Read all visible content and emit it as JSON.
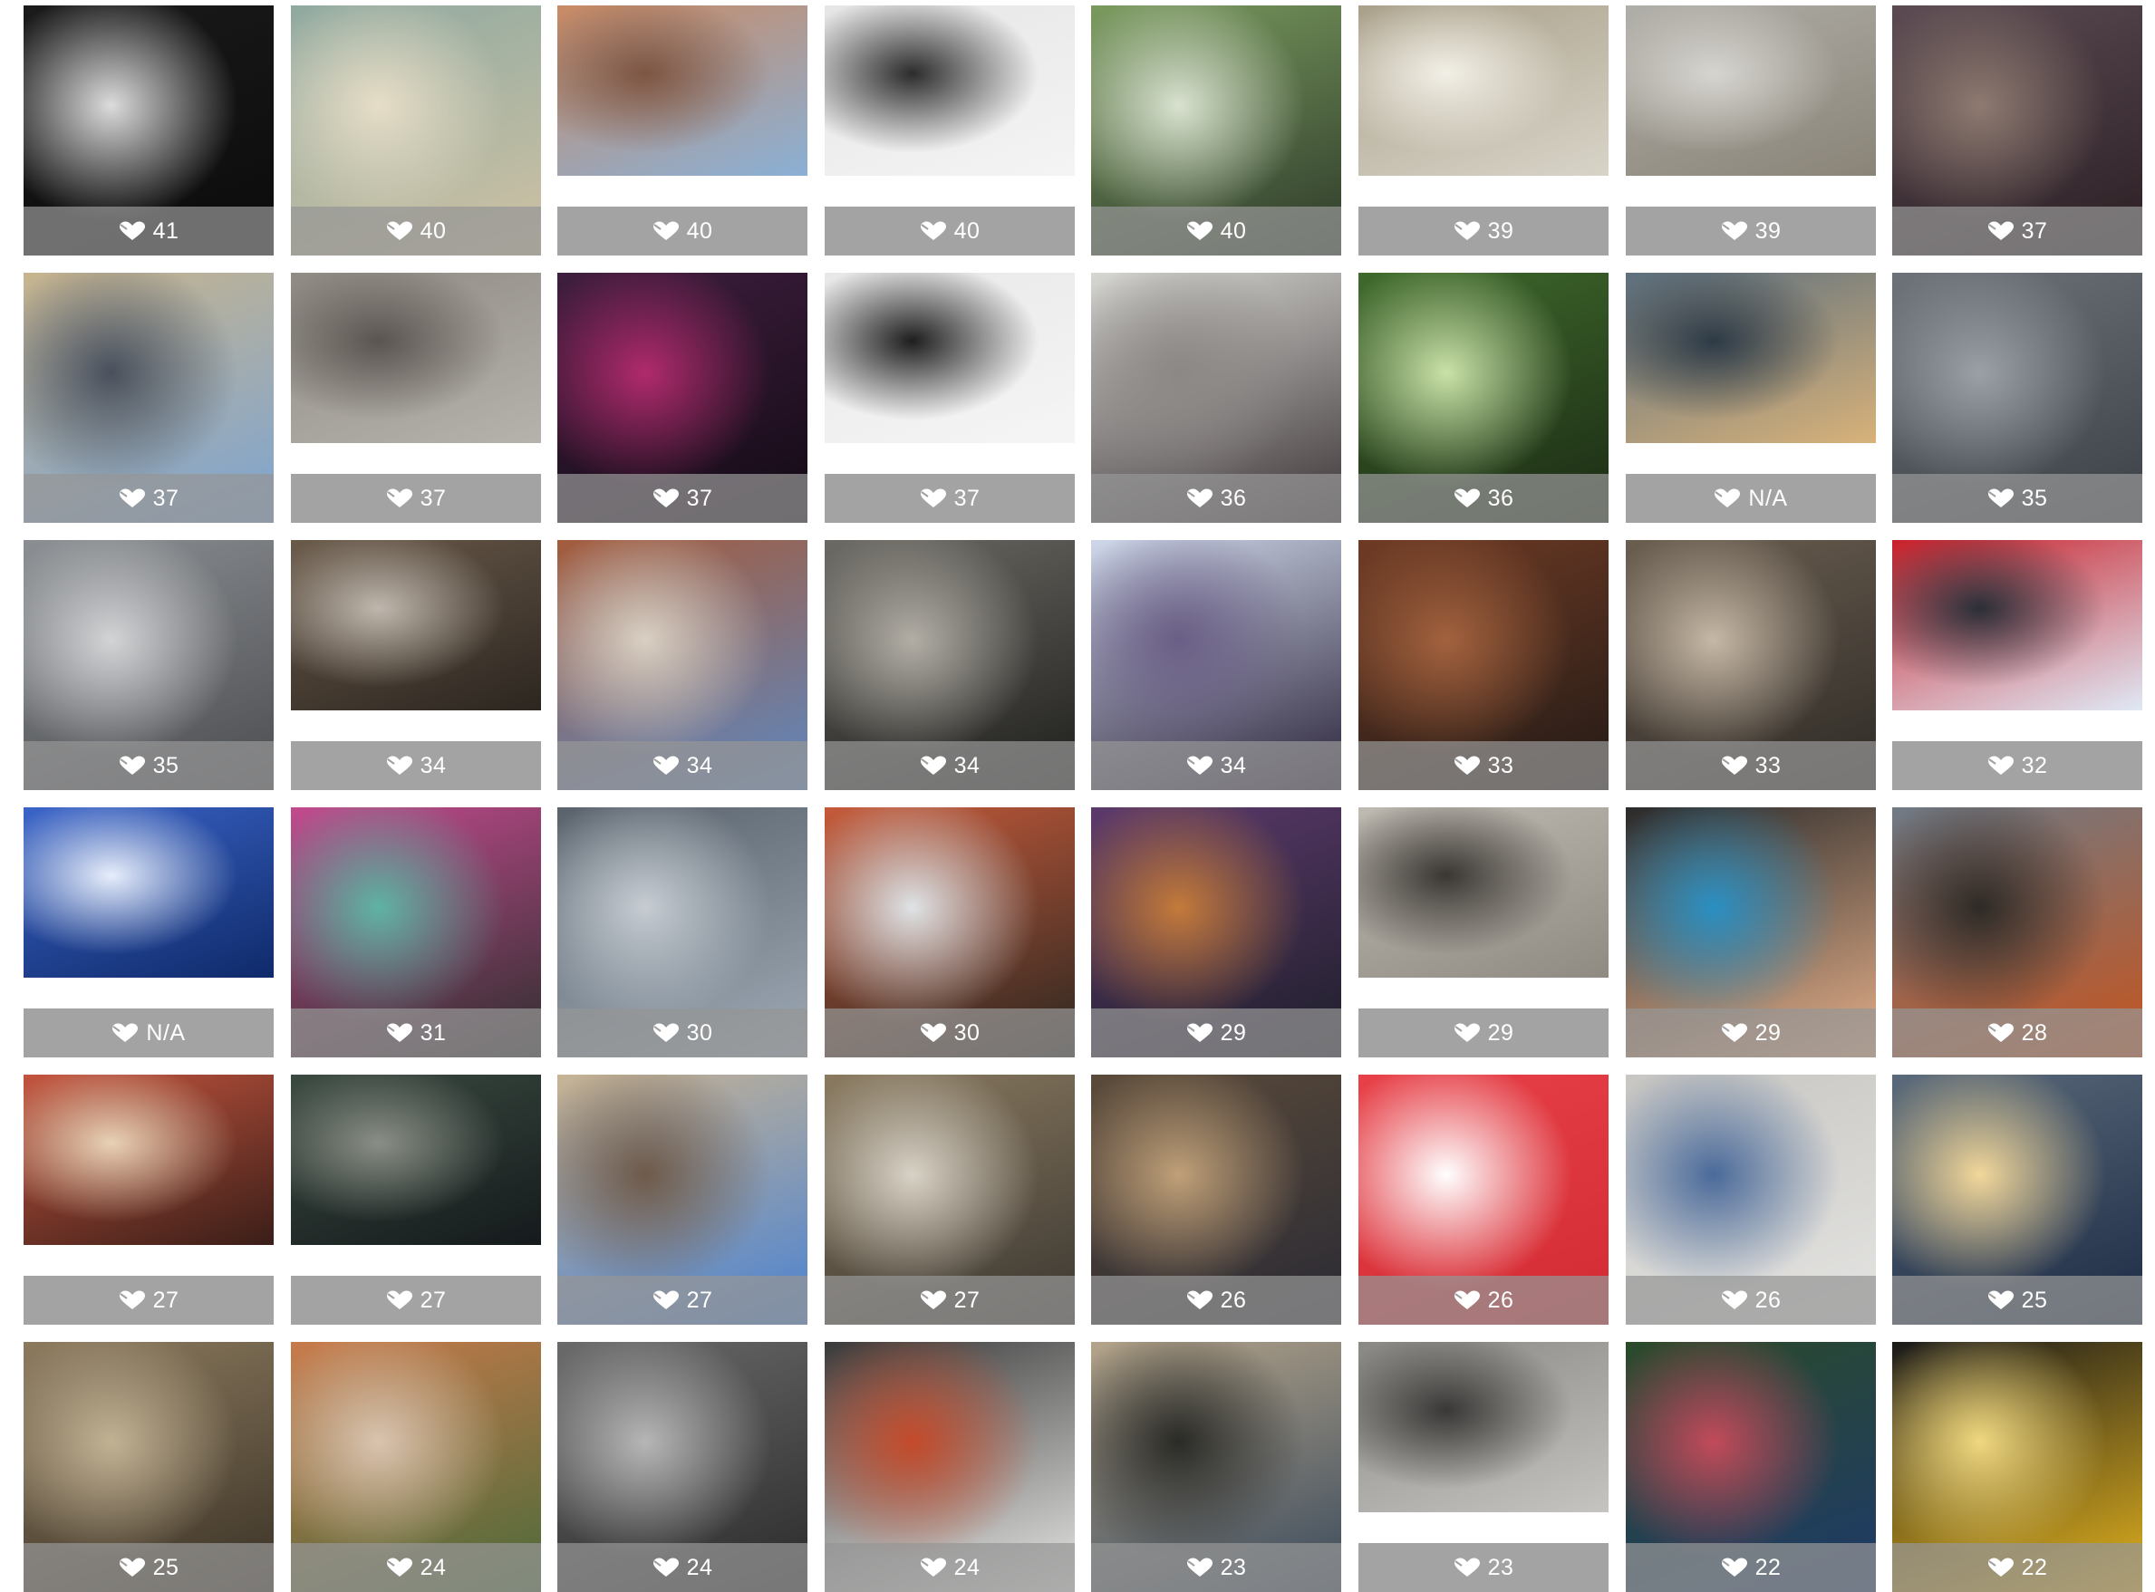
{
  "gallery": {
    "like_icon": "heart-icon",
    "tiles": [
      {
        "likes": "41",
        "colors": [
          "#0b0b0b",
          "#1a1a1a",
          "#dcdcdc"
        ],
        "full": true
      },
      {
        "likes": "40",
        "colors": [
          "#cfc2a4",
          "#8fa9a0",
          "#e6ddc7"
        ],
        "full": true
      },
      {
        "likes": "40",
        "colors": [
          "#8ab0d6",
          "#c98a64",
          "#7d5542"
        ],
        "full": false
      },
      {
        "likes": "40",
        "colors": [
          "#f4f4f4",
          "#e6e6e6",
          "#2c2c2c"
        ],
        "full": false
      },
      {
        "likes": "40",
        "colors": [
          "#2d3a2a",
          "#7a9a5e",
          "#d9e2d0"
        ],
        "full": true
      },
      {
        "likes": "39",
        "colors": [
          "#d8d4c8",
          "#a9a08a",
          "#f2efe6"
        ],
        "full": false
      },
      {
        "likes": "39",
        "colors": [
          "#8a8478",
          "#b0aea8",
          "#d7d5d0"
        ],
        "full": false
      },
      {
        "likes": "37",
        "colors": [
          "#2a1f24",
          "#5b4a52",
          "#8e7a70"
        ],
        "full": true
      },
      {
        "likes": "37",
        "colors": [
          "#7ca4d2",
          "#c7b48e",
          "#49505c"
        ],
        "full": true
      },
      {
        "likes": "37",
        "colors": [
          "#b6b2ac",
          "#8f8a84",
          "#5a5550"
        ],
        "full": false
      },
      {
        "likes": "37",
        "colors": [
          "#120a14",
          "#3e1e3e",
          "#b02a6c"
        ],
        "full": true
      },
      {
        "likes": "37",
        "colors": [
          "#f5f5f5",
          "#e8e8e8",
          "#1e1e1e"
        ],
        "full": false
      },
      {
        "likes": "36",
        "colors": [
          "#3c3436",
          "#d7d7d3",
          "#8c8886"
        ],
        "full": true
      },
      {
        "likes": "36",
        "colors": [
          "#1b2a14",
          "#3f6a2c",
          "#c9e2a8"
        ],
        "full": true
      },
      {
        "likes": "N/A",
        "colors": [
          "#d8b27a",
          "#5c6f7e",
          "#2d3a46"
        ],
        "full": false
      },
      {
        "likes": "35",
        "colors": [
          "#3b4046",
          "#6d7279",
          "#9aa0a6"
        ],
        "full": true
      },
      {
        "likes": "35",
        "colors": [
          "#4a4c50",
          "#8b8e92",
          "#d2d4d6"
        ],
        "full": true
      },
      {
        "likes": "34",
        "colors": [
          "#2c2620",
          "#6a5a4a",
          "#bfb7ad"
        ],
        "full": false
      },
      {
        "likes": "34",
        "colors": [
          "#5e88c0",
          "#a35b3c",
          "#d9d0c2"
        ],
        "full": true
      },
      {
        "likes": "34",
        "colors": [
          "#1d1d1b",
          "#6c6a64",
          "#b2aea6"
        ],
        "full": true
      },
      {
        "likes": "34",
        "colors": [
          "#2a2238",
          "#cfd8ea",
          "#6a5e86"
        ],
        "full": true
      },
      {
        "likes": "33",
        "colors": [
          "#221a16",
          "#6e3a24",
          "#a3623e"
        ],
        "full": true
      },
      {
        "likes": "33",
        "colors": [
          "#2e2a26",
          "#6a5e50",
          "#c6b8a6"
        ],
        "full": true
      },
      {
        "likes": "32",
        "colors": [
          "#dfe9f5",
          "#c8202a",
          "#2a2f38"
        ],
        "full": false
      },
      {
        "likes": "N/A",
        "colors": [
          "#0f2a6a",
          "#3a64c8",
          "#e7eefb"
        ],
        "full": false
      },
      {
        "likes": "31",
        "colors": [
          "#2e2e2e",
          "#c24a8e",
          "#5fb3a4"
        ],
        "full": true
      },
      {
        "likes": "30",
        "colors": [
          "#9eaab6",
          "#5a636c",
          "#c6ccd2"
        ],
        "full": true
      },
      {
        "likes": "30",
        "colors": [
          "#2a2620",
          "#c55a3a",
          "#dfe3e6"
        ],
        "full": true
      },
      {
        "likes": "29",
        "colors": [
          "#1e1e2a",
          "#5c3a6c",
          "#c47a3a"
        ],
        "full": true
      },
      {
        "likes": "29",
        "colors": [
          "#8f8a82",
          "#bfbab2",
          "#3a3632"
        ],
        "full": false
      },
      {
        "likes": "29",
        "colors": [
          "#e6b08a",
          "#2a2a2a",
          "#2a8fc2"
        ],
        "full": true
      },
      {
        "likes": "28",
        "colors": [
          "#c5541e",
          "#6f7a86",
          "#2e2a26"
        ],
        "full": true
      },
      {
        "likes": "27",
        "colors": [
          "#3a1e18",
          "#c4543e",
          "#e8d2b6"
        ],
        "full": false
      },
      {
        "likes": "27",
        "colors": [
          "#151a1c",
          "#3a4a40",
          "#8a8f86"
        ],
        "full": false
      },
      {
        "likes": "27",
        "colors": [
          "#4a82d2",
          "#c8b494",
          "#6e5a4a"
        ],
        "full": true
      },
      {
        "likes": "27",
        "colors": [
          "#3a3630",
          "#8a7a60",
          "#d8d2c6"
        ],
        "full": true
      },
      {
        "likes": "26",
        "colors": [
          "#2a2a34",
          "#5a4a3a",
          "#c0a078"
        ],
        "full": true
      },
      {
        "likes": "26",
        "colors": [
          "#d32b33",
          "#e84048",
          "#ffffff"
        ],
        "full": true
      },
      {
        "likes": "26",
        "colors": [
          "#e4e4e2",
          "#c8c6c2",
          "#4a6a9a"
        ],
        "full": true
      },
      {
        "likes": "25",
        "colors": [
          "#1c2a44",
          "#5a6a7a",
          "#f2d79a"
        ],
        "full": true
      },
      {
        "likes": "25",
        "colors": [
          "#3a3226",
          "#8c7a5e",
          "#c2b294"
        ],
        "full": true
      },
      {
        "likes": "24",
        "colors": [
          "#4a6a3a",
          "#c87a4a",
          "#d9c4b0"
        ],
        "full": true
      },
      {
        "likes": "24",
        "colors": [
          "#2a2a2a",
          "#6a6a6a",
          "#b6b6b6"
        ],
        "full": true
      },
      {
        "likes": "24",
        "colors": [
          "#e8e8e6",
          "#3a3a3a",
          "#c44a2a"
        ],
        "full": true
      },
      {
        "likes": "23",
        "colors": [
          "#3a4a5c",
          "#b4a48a",
          "#2a2a26"
        ],
        "full": true
      },
      {
        "likes": "23",
        "colors": [
          "#c6c4c0",
          "#8a8884",
          "#3a3836"
        ],
        "full": false
      },
      {
        "likes": "22",
        "colors": [
          "#1e3a6a",
          "#2a4a2a",
          "#c24a5a"
        ],
        "full": true
      },
      {
        "likes": "22",
        "colors": [
          "#e2b21e",
          "#1a1a1a",
          "#f0d880"
        ],
        "full": true
      }
    ]
  }
}
